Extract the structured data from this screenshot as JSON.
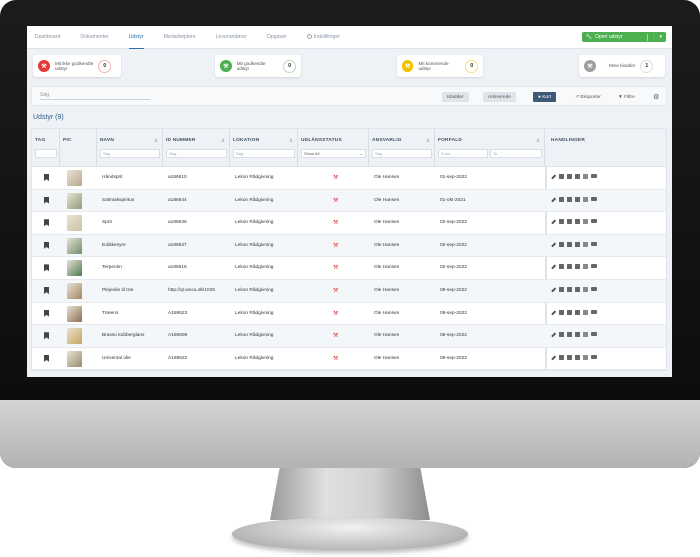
{
  "nav": {
    "tabs": [
      "Dashboard",
      "Dokumenter",
      "Udstyr",
      "Medarbejdere",
      "Leverandører",
      "Opgaver",
      "Indstillinger"
    ],
    "active": "Udstyr",
    "create_label": "Opret udstyr"
  },
  "cards": [
    {
      "label_line1": "Mit ikke godkendte",
      "label_line2": "udstyr",
      "count": "0",
      "color": "#e53935"
    },
    {
      "label_line1": "Mit godkendte udstyr",
      "label_line2": "",
      "count": "0",
      "color": "#4caf50"
    },
    {
      "label_line1": "Mit kommende udstyr",
      "label_line2": "",
      "count": "0",
      "color": "#f2c200"
    },
    {
      "label_line1": "Mine kladder",
      "label_line2": "",
      "count": "1",
      "color": "#9e9e9e"
    }
  ],
  "toolbar": {
    "search_placeholder": "Søg",
    "kladder": "Kladder",
    "arkiverede": "Arkiverede",
    "kort": "Kort",
    "eksporter": "Eksporter",
    "filtre": "Filtre"
  },
  "title": "Udstyr (9)",
  "columns": {
    "tag": "TAG",
    "pic": "PIC",
    "navn": "NAVN",
    "id": "ID NUMMER",
    "lokation": "LOKATION",
    "udlaan": "UDLÅNSSTATUS",
    "ansvarlig": "ANSVARLIG",
    "forfald": "FORFALD",
    "handlinger": "HANDLINGER"
  },
  "filters": {
    "navn": "Søg",
    "id": "Søg",
    "lokation": "Søg",
    "udlaan": "Show All",
    "ansvarlig": "Søg",
    "from": "From",
    "to": "To"
  },
  "rows": [
    {
      "navn": "Håndsprit",
      "id": "a186610",
      "lok": "Lekon Rådgivning",
      "ansv": "Ole Hansen",
      "forfald": "01-sep-2022"
    },
    {
      "navn": "Salmiakspiritus",
      "id": "a186644",
      "lok": "Lekon Rådgivning",
      "ansv": "Ole Hansen",
      "forfald": "01-okt-2021"
    },
    {
      "navn": "Sprit",
      "id": "a186636",
      "lok": "Lekon Rådgivning",
      "ansv": "Ole Hansen",
      "forfald": "02-sep-2022"
    },
    {
      "navn": "Eddikesyre",
      "id": "a186637",
      "lok": "Lekon Rådgivning",
      "ansv": "Ole Hansen",
      "forfald": "02-sep-2022"
    },
    {
      "navn": "Terpentin",
      "id": "a186616",
      "lok": "Lekon Rådgivning",
      "ansv": "Ole Hansen",
      "forfald": "02-sep-2022"
    },
    {
      "navn": "Plejeolie til træ",
      "id": "http://qr.woca.dk/1028",
      "lok": "Lekon Rådgivning",
      "ansv": "Ole Hansen",
      "forfald": "08-sep-2022"
    },
    {
      "navn": "Træens",
      "id": "A188623",
      "lok": "Lekon Rådgivning",
      "ansv": "Ole Hansen",
      "forfald": "08-sep-2022"
    },
    {
      "navn": "Brasso kobberglans",
      "id": "A188608",
      "lok": "Lekon Rådgivning",
      "ansv": "Ole Hansen",
      "forfald": "08-sep-2022"
    },
    {
      "navn": "Universal olie",
      "id": "A188622",
      "lok": "Lekon Rådgivning",
      "ansv": "Ole Hansen",
      "forfald": "08-sep-2022"
    }
  ],
  "pic_colors": [
    "#b9a78f",
    "#8f9b7a",
    "#c9c3a6",
    "#6c8f6a",
    "#4d7a52",
    "#a48562",
    "#8b6f4e",
    "#c8a35a",
    "#9a8a6c"
  ]
}
